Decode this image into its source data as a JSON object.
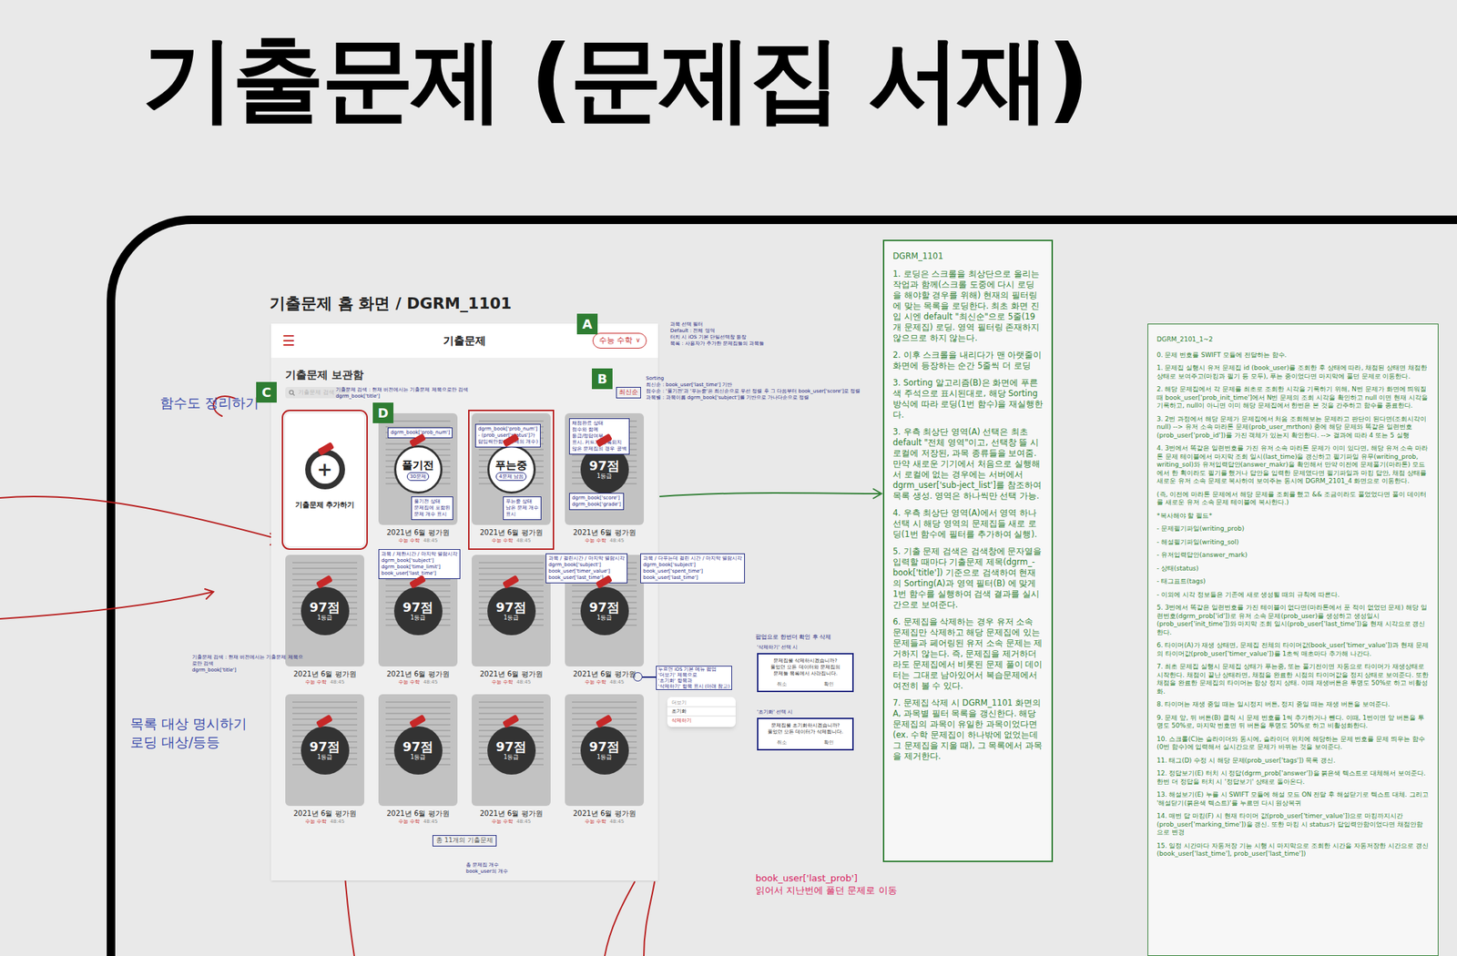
{
  "page_title": "기출문제 (문제집 서재)",
  "screen_label": "기출문제 홈 화면 / DGRM_1101",
  "side_notes": [
    {
      "lines": [
        "함수도 정리하기"
      ]
    },
    {
      "lines": [
        "목록 대상 명시하기",
        "로딩 대상/등등"
      ]
    }
  ],
  "phone": {
    "menu_icon": "☰",
    "title": "기출문제",
    "subject_filter": "수능 수학",
    "caret": "∨",
    "library_title": "기출문제 보관함",
    "search_placeholder": "기출문제 검색",
    "sort": "최신순",
    "add_card": {
      "icon": "+",
      "label": "기출문제 추가하기"
    },
    "cards": [
      {
        "kind": "before",
        "main": "풀기전",
        "sub": "30문제",
        "date": "2021년 6월 평가원",
        "subject": "수능 수학",
        "meta": "48:45"
      },
      {
        "kind": "progress",
        "main": "푸는중",
        "sub": "4문제 남음",
        "date": "2021년 6월 평가원",
        "subject": "수능 수학",
        "meta": "48:45"
      },
      {
        "kind": "graded",
        "main": "97점",
        "sub": "1등급",
        "date": "2021년 6월 평가원",
        "subject": "수능 수학",
        "meta": "48:45"
      },
      {
        "kind": "graded",
        "main": "97점",
        "sub": "1등급",
        "date": "2021년 6월 평가원",
        "subject": "수능 수학",
        "meta": "48:45"
      },
      {
        "kind": "graded",
        "main": "97점",
        "sub": "1등급",
        "date": "2021년 6월 평가원",
        "subject": "수능 수학",
        "meta": "48:45"
      },
      {
        "kind": "graded",
        "main": "97점",
        "sub": "1등급",
        "date": "2021년 6월 평가원",
        "subject": "수능 수학",
        "meta": "48:45"
      },
      {
        "kind": "graded",
        "main": "97점",
        "sub": "1등급",
        "date": "2021년 6월 평가원",
        "subject": "수능 수학",
        "meta": "48:45"
      },
      {
        "kind": "graded",
        "main": "97점",
        "sub": "1등급",
        "date": "2021년 6월 평가원",
        "subject": "수능 수학",
        "meta": "48:45"
      },
      {
        "kind": "graded",
        "main": "97점",
        "sub": "1등급",
        "date": "2021년 6월 평가원",
        "subject": "수능 수학",
        "meta": "48:45"
      },
      {
        "kind": "graded",
        "main": "97점",
        "sub": "1등급",
        "date": "2021년 6월 평가원",
        "subject": "수능 수학",
        "meta": "48:45"
      },
      {
        "kind": "graded",
        "main": "97점",
        "sub": "1등급",
        "date": "2021년 6월 평가원",
        "subject": "수능 수학",
        "meta": "48:45"
      }
    ],
    "total": "총 11개의 기출문제"
  },
  "badges": [
    "A",
    "B",
    "C",
    "D"
  ],
  "annotations": [
    {
      "lines": [
        "과목 선택 필터",
        "Default : 전체 영역",
        "터치 시 iOS 기본 단일선택창 등장",
        "목록 : 사용자가 추가한 문제집들의 과목들"
      ]
    },
    {
      "lines": [
        "Sorting",
        "최신순 : book_user['last_time'] 기반",
        "점수순 : '풀기전'과 '푸는중'은 최신순으로 우선 정렬 후 그 다음부터 book_user['score']로 정렬",
        "과목별 : 과목이름 dgrm_book['subject']를 기반으로 가나다순으로 정렬"
      ]
    },
    {
      "lines": [
        "기출문제 검색 : 현재 버전에서는 기출문제 제목으로만 검색",
        "dgrm_book['title']"
      ]
    },
    {
      "lines": [
        "dgrm_book['prob_num']"
      ]
    },
    {
      "lines": [
        "풀기전 상태",
        "문제집에 포함된",
        "문제 개수 표시"
      ]
    },
    {
      "lines": [
        "dgrm_book['prob_num']",
        "- (prob_user['status']가",
        "답입력안함인 문제의 개수)"
      ]
    },
    {
      "lines": [
        "푸는중 상태",
        "남은 문제 개수",
        "표시"
      ]
    },
    {
      "lines": [
        "채점완료 상태",
        "점수와 함께",
        "등급/정답여부",
        "표시. 커트가 등록되지",
        "않은 문제집의 경우 공백"
      ]
    },
    {
      "lines": [
        "dgrm_book['score']",
        "dgrm_book['grade']"
      ]
    },
    {
      "lines": [
        "과목 / 제한시간 / 마지막 열람시각",
        "dgrm_book['subject']",
        "dgrm_book['time_limit']",
        "book_user['last_time']"
      ]
    },
    {
      "lines": [
        "과목 / 걸린시간 / 마지막 열람시각",
        "dgrm_book['subject']",
        "book_user['timer_value']",
        "book_user['last_time']"
      ]
    },
    {
      "lines": [
        "과목 / 다푸는데 걸린 시간 / 마지막 열람시각",
        "dgrm_book['subject']",
        "book_user['spent_time']",
        "book_user['last_time']"
      ]
    },
    {
      "lines": [
        "기출문제 검색 : 현재 버전에서는 기출문제 제목으로만 검색",
        "dgrm_book['title']"
      ]
    },
    {
      "lines": [
        "총 문제집 개수",
        "book_user의 개수"
      ]
    }
  ],
  "popup": {
    "header": "팝업으로 한번더 확인 후 삭제",
    "hint": [
      "누르면 iOS 기본 메뉴 팝업",
      "'더보기' 제목으로",
      "'초기화' 항목과",
      "'삭제하기' 항목 표시 (아래 참고)"
    ],
    "menu_title": "더보기",
    "menu_items": [
      "초기화",
      "삭제하기"
    ],
    "dialogs": [
      {
        "trigger": "'삭제하기' 선택 시",
        "message": [
          "문제집을 삭제하시겠습니까?",
          "풀었던 모든 데이터와 문제집의",
          "문제들 목록에서 사라집니다."
        ],
        "cancel": "취소",
        "confirm": "확인"
      },
      {
        "trigger": "'초기화' 선택 시",
        "message": [
          "문제집을 초기화하시겠습니까?",
          "풀었던 모든 데이터가 삭제됩니다."
        ],
        "cancel": "취소",
        "confirm": "확인"
      }
    ]
  },
  "last_prob_note": [
    "book_user['last_prob']",
    "읽어서 지난번에 풀던 문제로 이동"
  ],
  "spec_1101": {
    "title": "DGRM_1101",
    "paragraphs": [
      "1. 로딩은 스크롤을 최상단으로 올리는 작업과 함께(스크롤 도중에 다시 로딩을 해야할 경우를 위해) 현재의 필터링에 맞는 목록을 로딩한다. 최초 화면 진입 시엔 default \"최신순\"으로 5줄(19개 문제집) 로딩. 영역 필터링 존재하지 않으므로 하지 않는다.",
      "2. 이후 스크롤을 내리다가 맨 아랫줄이 화면에 등장하는 순간 5줄씩 더 로딩",
      "3. Sorting 알고리즘(B)은 화면에 푸른색 주석으로 표시된대로, 해당 Sorting 방식에 따라 로딩(1번 함수)을 재실행한다.",
      "3. 우측 최상단 영역(A) 선택은 최초 default \"전체 영역\"이고, 선택창 뜰 시 로컬에 저장된, 과목 종류들을 보여줌. 만약 새로운 기기에서 처음으로 실행해서 로컬에 없는 경우에는 서버에서 dgrm_user['sub-ject_list']를 참조하여 목록 생성. 영역은 하나씩만 선택 가능.",
      "4. 우측 최상단 영역(A)에서 영역 하나 선택 시 해당 영역의 문제집들 새로 로딩(1번 함수에 필터를 추가하여 실행).",
      "5. 기출 문제 검색은 검색창에 문자열을 입력할 때마다 기출문제 제목(dgrm_-book['title']) 기준으로 검색하여 현재의 Sorting(A)과 영역 필터(B) 에 맞게 1번 함수를 실행하여 검색 결과를 실시간으로 보여준다.",
      "6. 문제집을 삭제하는 경우 유저 소속 문제집만 삭제하고 해당 문제집에 있는 문제들과 페어링된 유저 소속 문제는 제거하지 않는다. 즉, 문제집을 제거하더라도 문제집에서 비롯된 문제 풀이 데이터는 그대로 남아있어서 복습문제에서 여전히 볼 수 있다.",
      "7. 문제집 삭제 시 DGRM_1101 화면의 A, 과목별 필터 목록을 갱신한다. 해당 문제집의 과목이 유일한 과목이었다면(ex. 수학 문제집이 하나밖에 없었는데 그 문제집을 지울 때), 그 목록에서 과목을 제거한다."
    ]
  },
  "spec_2101": {
    "title": "DGRM_2101_1~2",
    "paragraphs": [
      "0. 문제 번호를 SWIFT 모듈에 전달하는 함수.",
      "1. 문제집 실행시 유저 문제집 id (book_user)를 조회한 후 상태에 따라, 채점된 상태면 채점한 상태로 보여주고(마킹과 필기 등 모두), 푸는 중이었다면 마지막에 풀던 문제로 이동한다.",
      "2. 해당 문제집에서 각 문제를 최초로 조회한 시각을 기록하기 위해, N번 문제가 화면에 띄워질 때 book_user['prob_init_time']에서 N번 문제의 조회 시각을 확인하고 null 이면 현재 시각을 기록하고, null이 아니면 이미 해당 문제집에서 한번은 본 것을 간주하고 함수를 종료한다.",
      "3. 2번 과정에서 해당 문제가 문제집에서 처음 조회해보는 문제라고 판단이 된다면(조회시각이 null) --> 유저 소속 마라톤 문제(prob_user_mrthon) 중에 해당 문제와 똑같은 일련번호(prob_user['prob_id'])를 가진 객체가 있는지 확인한다. --> 결과에 따라 4 또는 5 실행",
      "4. 3번에서 똑같은 일련번호를 가진 유저 소속 마라톤 문제가 이미 있다면, 해당 유저 소속 마라톤 문제 테이블에서 마지막 조회 일시(last_time)을 갱신하고 필기파일 유무(writing_prob, writing_sol)와 유저입력답안(answer_makr)을 확인해서 만약 이전에 문제풀기(마라톤) 모드에서 한 획이라도 필기를 했거나 답안을 입력한 문제였다면 필기파일과 마킹 답안, 채점 상태를 새로운 유저 소속 문제로 복사하여 보여주는 동시에 DGRM_2101_4 화면으로 이동한다.",
      "(즉, 이전에 마라톤 문제에서 해당 문제를 조회를 했고 && 조금이라도 풀었었다면 풀이 데이터를 새로운 유저 소속 문제 테이블에 복사한다.)",
      "*복사해야 할 필드*",
      "- 문제필기파일(writing_prob)",
      "- 해설필기파일(writing_sol)",
      "- 유저입력답안(answer_mark)",
      "- 상태(status)",
      "- 태그표트(tags)",
      "- 이외에 시각 정보들은 기존에 새로 생성될 때의 규칙에 따른다.",
      "5. 3번에서 똑같은 일련번호를 가진 테이블이 없다면(마라톤에서 푼 적이 없었던 문제) 해당 일련번호(dgrm_prob['id'])로 유저 소속 문제(prob_user)를 생성하고 생성일시(prob_user['init_time'])와 마지막 조회 일시(prob_user['last_time'])을 현재 시각으로 갱신한다.",
      "6. 타이머(A)가 재생 상태면, 문제집 전체의 타이머값(book_user['timer_value'])과 현재 문제의 타이머값(prob_user['timer_value'])를 1초씩 매초마다 추가해 나간다.",
      "7. 최초 문제집 실행시 문제집 상태가 푸는중, 또는 풀기전이면 자동으로 타이머가 재생상태로 시작한다. 채점이 끝난 상태라면, 채점을 완료한 시점의 타이머값을 정지 상태로 보여준다. 또한 채점을 완료한 문제집의 타이머는 항상 정지 상태. 이때 재생버튼은 투명도 50%로 하고 비활성화.",
      "8. 타이머는 재생 중일 때는 일시정지 버튼, 정지 중일 때는 재생 버튼을 보여준다.",
      "9. 문제 앞, 뒤 버튼(B) 클릭 시 문제 번호를 1씩 추가하거나 뺀다. 이때, 1번이면 앞 버튼을 투명도 50%로, 마지막 번호면 뒤 버튼을 투명도 50%로 하고 비활성화한다.",
      "10. 스크롤(C)는 슬라이더와 동시에, 슬라이더 위치에 해당하는 문제 번호를 문제 띄우는 함수(0번 함수)에 입력해서 실시간으로 문제가 바뀌는 것을 보여준다.",
      "11. 태그(D) 수정 시 해당 문제(prob_user['tags']) 목록 갱신.",
      "12. 정답보기(E) 터치 시 정답(dgrm_prob['answer'])을 붉은색 텍스트로 대체해서 보여준다. 한번 더 정답을 터치 시 '정답보기' 상태로 돌아온다.",
      "13. 해설보기(E) 누를 시 SWIFT 모듈에 해설 모드 ON 전달 후 해설닫기로 텍스트 대체. 그리고 '해설닫기(붉은색 텍스트)'를 누르면 다시 원상복귀",
      "14. 매번 답 마킹(F) 시 현재 타이머 값(prob_user['timer_value'])으로 마킹까지시간(prob_user['marking_time'])을 갱신. 또한 마킹 시 status가 답입력안함이었다면 채점안함으로 변경",
      "15. 일정 시간마다 자동저장 기능 시행 시 마지막으로 조회한 시간을 자동저장한 시간으로 갱신(book_user['last_time'], prob_user['last_time'])"
    ]
  }
}
